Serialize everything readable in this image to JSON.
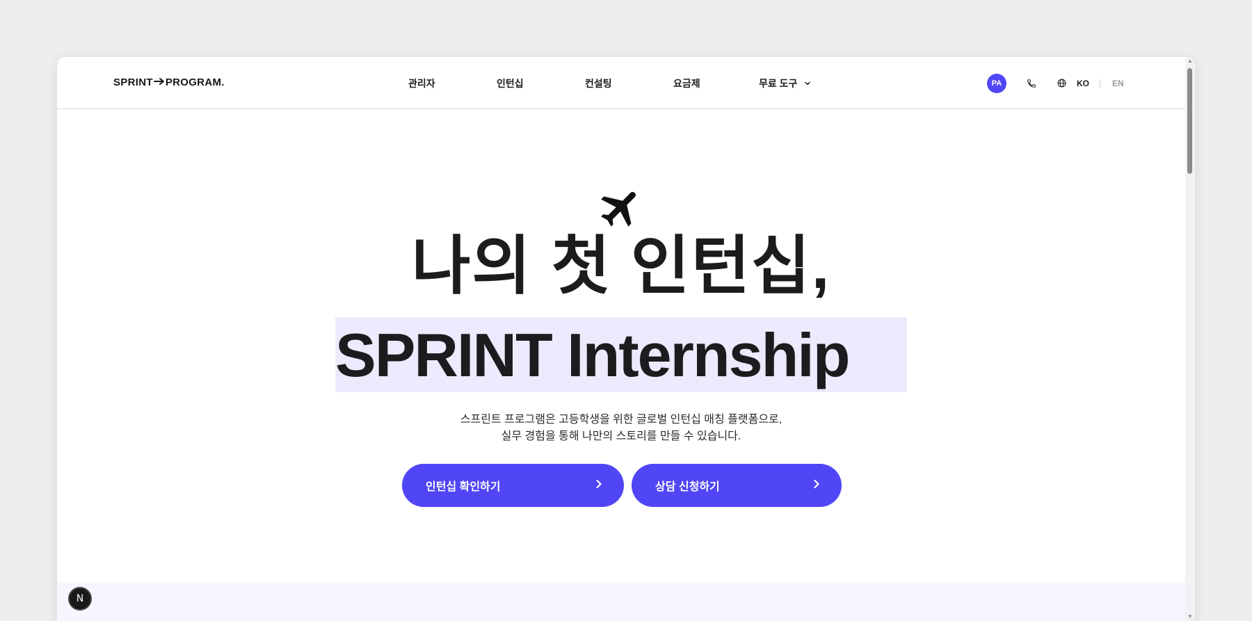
{
  "header": {
    "logo": {
      "left": "SPRINT",
      "right": "PROGRAM."
    },
    "nav": [
      {
        "label": "관리자"
      },
      {
        "label": "인턴십"
      },
      {
        "label": "컨설팅"
      },
      {
        "label": "요금제"
      },
      {
        "label": "무료 도구",
        "has_dropdown": true
      }
    ],
    "avatar_initials": "PA",
    "lang": {
      "ko": "KO",
      "separator": "|",
      "en": "EN"
    }
  },
  "hero": {
    "icon": "airplane-icon",
    "title_line1": "나의 첫 인턴십,",
    "title_line2": "SPRINT Internship",
    "description_line1": "스프린트 프로그램은 고등학생을 위한 글로벌 인턴십 매칭 플랫폼으로,",
    "description_line2": "실무 경험을 통해 나만의 스토리를 만들 수 있습니다.",
    "buttons": [
      {
        "label": "인턴십 확인하기"
      },
      {
        "label": "상담 신청하기"
      }
    ]
  },
  "dev_badge": "N",
  "colors": {
    "accent": "#5046f5",
    "highlight": "#ecebfd",
    "text": "#1c1c1e",
    "page_bg": "#eeeef0",
    "section_bg": "#f6f6fe"
  }
}
